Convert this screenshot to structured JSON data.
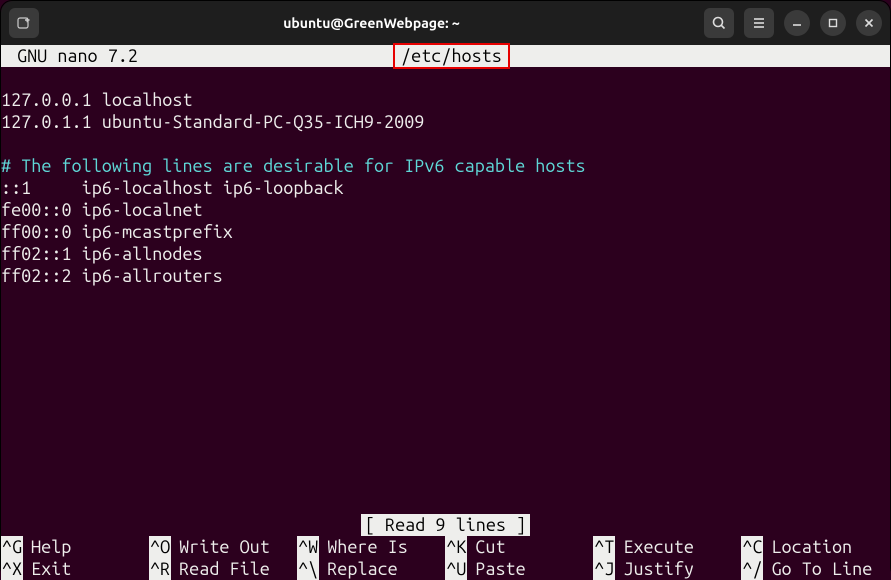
{
  "window": {
    "title": "ubuntu@GreenWebpage: ~"
  },
  "nano": {
    "version": "GNU nano 7.2",
    "filename": "/etc/hosts",
    "status": "[ Read 9 lines ]"
  },
  "file": {
    "line1": "127.0.0.1 localhost",
    "line2": "127.0.1.1 ubuntu-Standard-PC-Q35-ICH9-2009",
    "blank": "",
    "comment": "# The following lines are desirable for IPv6 capable hosts",
    "line3": "::1     ip6-localhost ip6-loopback",
    "line4": "fe00::0 ip6-localnet",
    "line5": "ff00::0 ip6-mcastprefix",
    "line6": "ff02::1 ip6-allnodes",
    "line7": "ff02::2 ip6-allrouters"
  },
  "shortcuts": {
    "row1": [
      {
        "key": "^G",
        "label": "Help"
      },
      {
        "key": "^O",
        "label": "Write Out"
      },
      {
        "key": "^W",
        "label": "Where Is"
      },
      {
        "key": "^K",
        "label": "Cut"
      },
      {
        "key": "^T",
        "label": "Execute"
      },
      {
        "key": "^C",
        "label": "Location"
      }
    ],
    "row2": [
      {
        "key": "^X",
        "label": "Exit"
      },
      {
        "key": "^R",
        "label": "Read File"
      },
      {
        "key": "^\\",
        "label": "Replace"
      },
      {
        "key": "^U",
        "label": "Paste"
      },
      {
        "key": "^J",
        "label": "Justify"
      },
      {
        "key": "^/",
        "label": "Go To Line"
      }
    ]
  }
}
